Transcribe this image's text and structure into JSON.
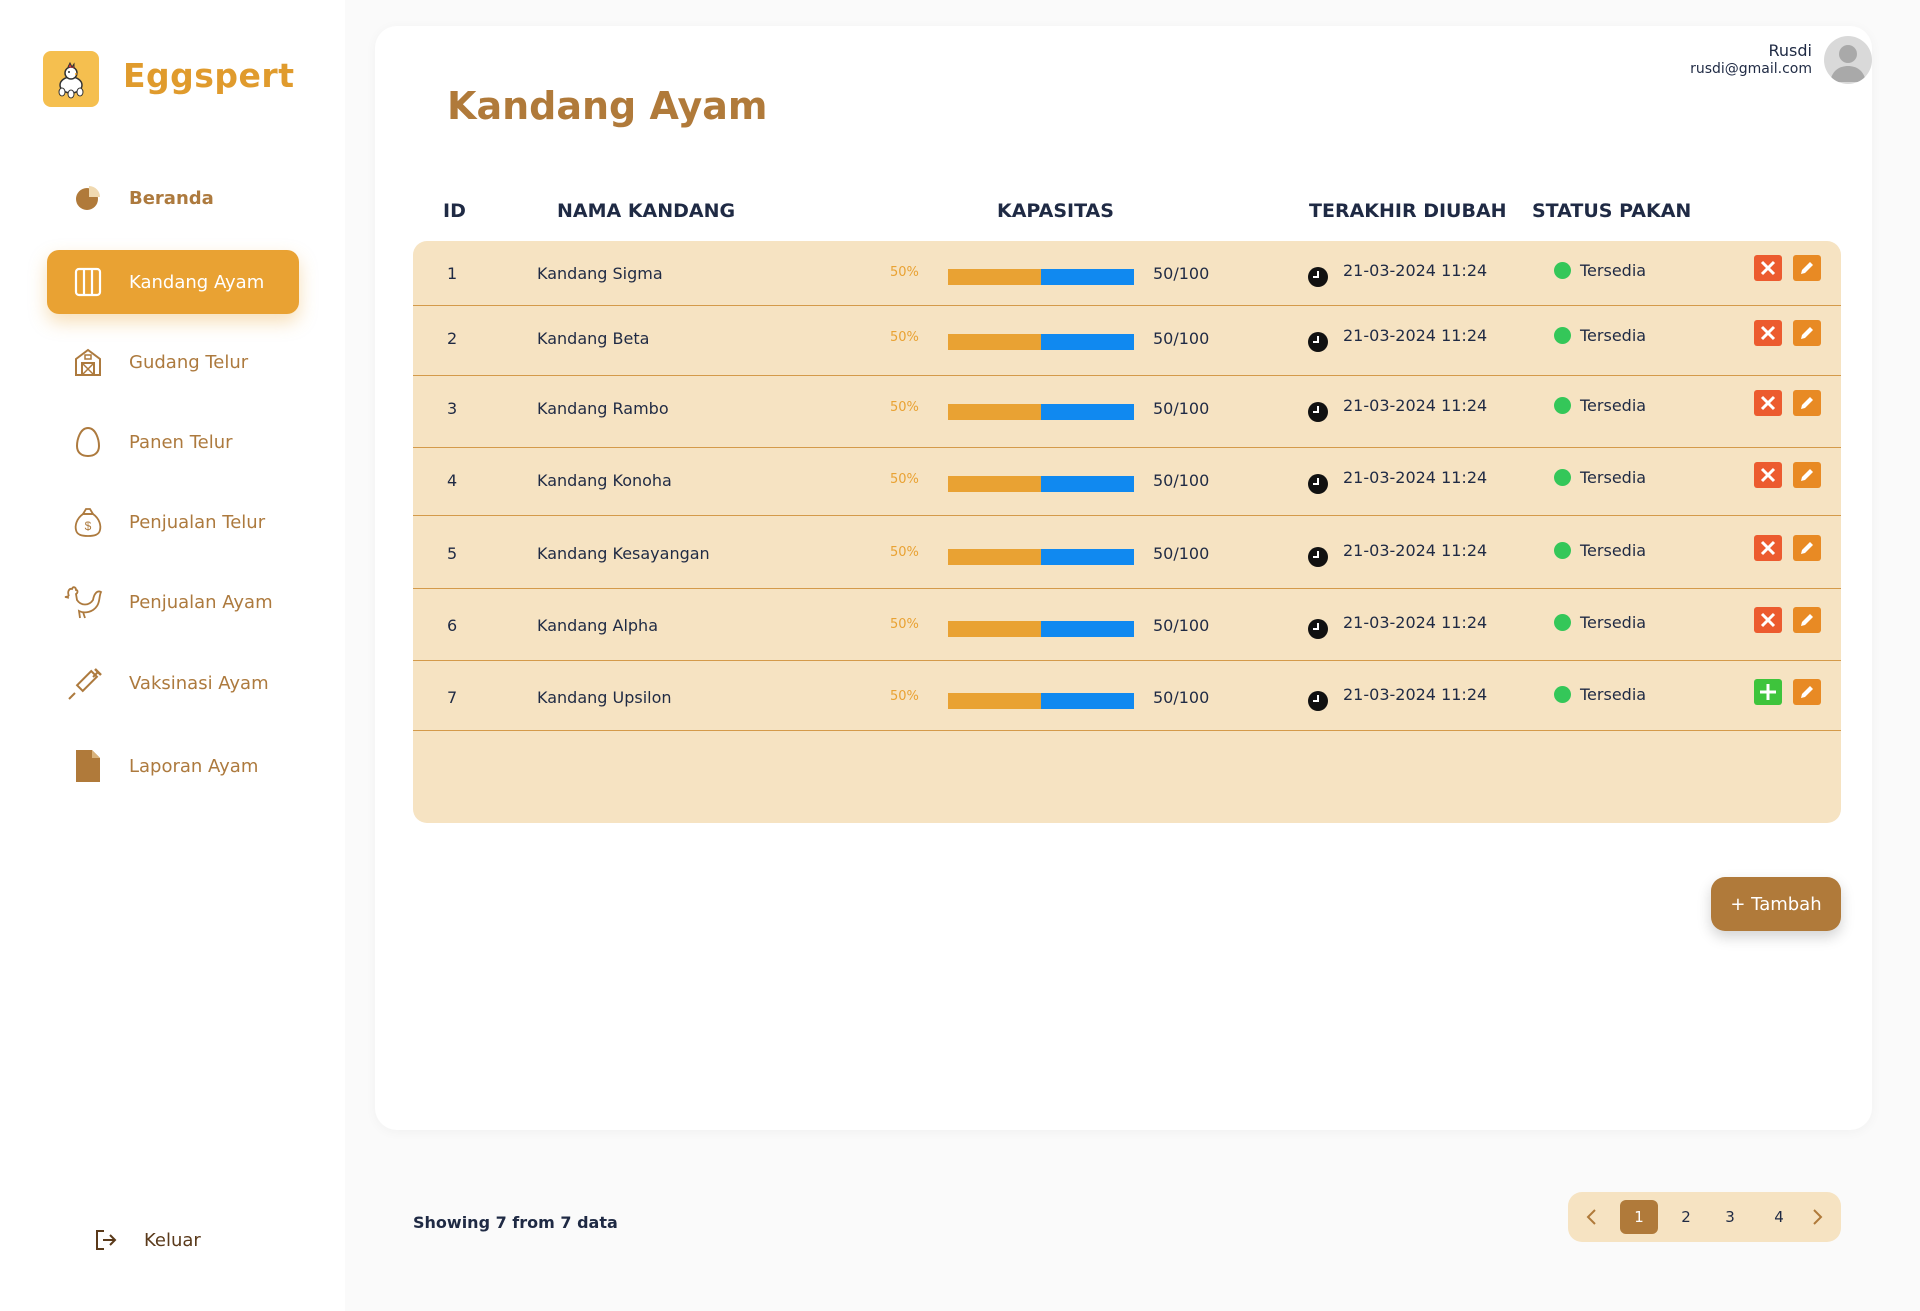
{
  "app": {
    "brand": "Eggspert",
    "accent_color": "#e9a233",
    "brand_brown": "#b07a3a"
  },
  "sidebar": {
    "items": [
      {
        "label": "Beranda",
        "icon": "pie-chart-icon"
      },
      {
        "label": "Kandang Ayam",
        "icon": "cage-icon",
        "active": true
      },
      {
        "label": "Gudang Telur",
        "icon": "barn-icon"
      },
      {
        "label": "Panen Telur",
        "icon": "egg-icon"
      },
      {
        "label": "Penjualan Telur",
        "icon": "money-bag-icon"
      },
      {
        "label": "Penjualan Ayam",
        "icon": "rooster-icon"
      },
      {
        "label": "Vaksinasi Ayam",
        "icon": "syringe-icon"
      },
      {
        "label": "Laporan Ayam",
        "icon": "document-icon"
      }
    ],
    "logout_label": "Keluar"
  },
  "header": {
    "title": "Kandang Ayam",
    "user_name": "Rusdi",
    "user_email": "rusdi@gmail.com"
  },
  "table": {
    "columns": [
      "ID",
      "NAMA KANDANG",
      "KAPASITAS",
      "TERAKHIR DIUBAH",
      "STATUS PAKAN"
    ],
    "rows": [
      {
        "id": "1",
        "name": "Kandang Sigma",
        "percent_label": "50%",
        "fill": 0.5,
        "capacity": "50/100",
        "updated": "21-03-2024 11:24",
        "status": "Tersedia",
        "action": "delete"
      },
      {
        "id": "2",
        "name": "Kandang Beta",
        "percent_label": "50%",
        "fill": 0.5,
        "capacity": "50/100",
        "updated": "21-03-2024 11:24",
        "status": "Tersedia",
        "action": "delete"
      },
      {
        "id": "3",
        "name": "Kandang Rambo",
        "percent_label": "50%",
        "fill": 0.5,
        "capacity": "50/100",
        "updated": "21-03-2024 11:24",
        "status": "Tersedia",
        "action": "delete"
      },
      {
        "id": "4",
        "name": "Kandang Konoha",
        "percent_label": "50%",
        "fill": 0.5,
        "capacity": "50/100",
        "updated": "21-03-2024 11:24",
        "status": "Tersedia",
        "action": "delete"
      },
      {
        "id": "5",
        "name": "Kandang Kesayangan",
        "percent_label": "50%",
        "fill": 0.5,
        "capacity": "50/100",
        "updated": "21-03-2024 11:24",
        "status": "Tersedia",
        "action": "delete"
      },
      {
        "id": "6",
        "name": "Kandang Alpha",
        "percent_label": "50%",
        "fill": 0.5,
        "capacity": "50/100",
        "updated": "21-03-2024 11:24",
        "status": "Tersedia",
        "action": "delete"
      },
      {
        "id": "7",
        "name": "Kandang Upsilon",
        "percent_label": "50%",
        "fill": 0.5,
        "capacity": "50/100",
        "updated": "21-03-2024 11:24",
        "status": "Tersedia",
        "action": "add"
      }
    ]
  },
  "actions": {
    "add_label": "+ Tambah"
  },
  "footer": {
    "showing": "Showing 7 from 7 data",
    "pages": [
      "1",
      "2",
      "3",
      "4"
    ],
    "current_page": "1"
  }
}
